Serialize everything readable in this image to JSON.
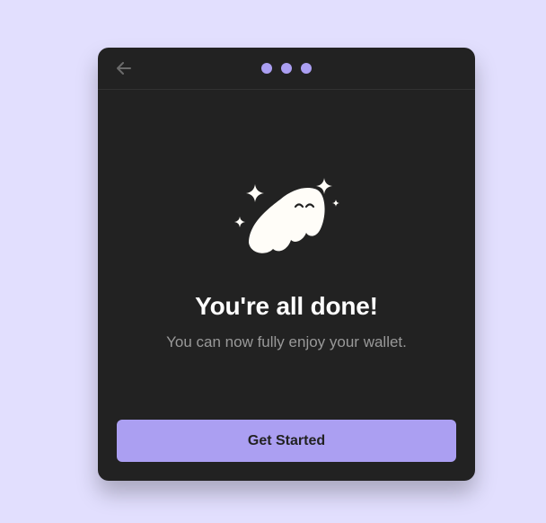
{
  "theme": {
    "page_background": "#e2dffe",
    "card_background": "#222222",
    "accent": "#ab9ff2",
    "title_color": "#ffffff",
    "subtitle_color": "#999999"
  },
  "topbar": {
    "back_icon": "arrow-left-icon",
    "step_dots": [
      {
        "state": "complete"
      },
      {
        "state": "complete"
      },
      {
        "state": "complete"
      }
    ]
  },
  "hero": {
    "illustration": "ghost-with-sparkles",
    "sparkle_icon": "sparkle-icon"
  },
  "content": {
    "title": "You're all done!",
    "subtitle": "You can now fully enjoy your wallet."
  },
  "actions": {
    "primary_label": "Get Started"
  }
}
